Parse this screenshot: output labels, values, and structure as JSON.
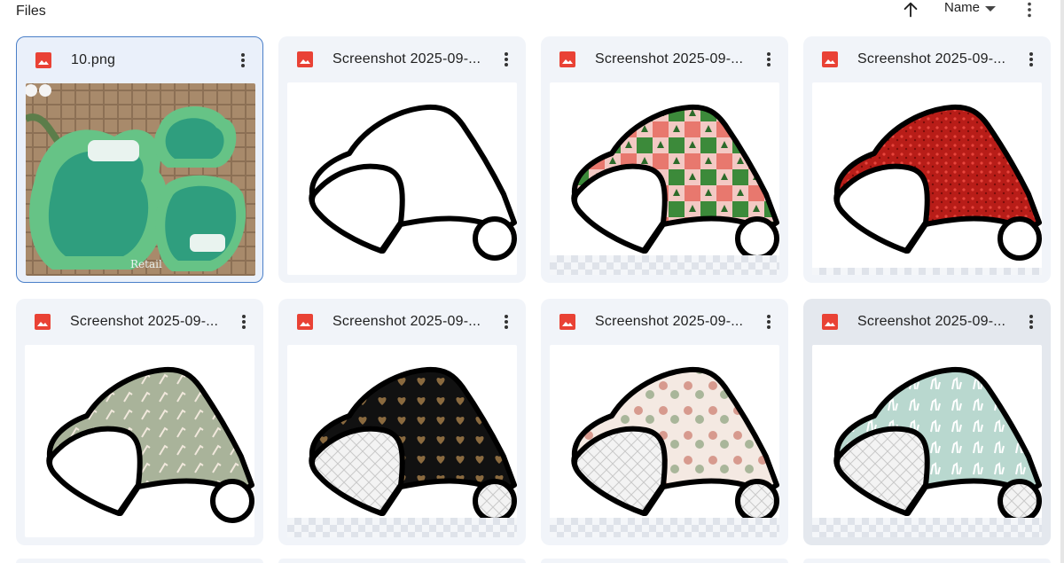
{
  "header": {
    "title": "Files",
    "sort_label": "Name"
  },
  "files": [
    {
      "name": "10.png",
      "type": "image",
      "thumb": "duck-mold",
      "selected": true
    },
    {
      "name": "Screenshot 2025-09-...",
      "type": "image",
      "thumb": "hat-outline"
    },
    {
      "name": "Screenshot 2025-09-...",
      "type": "image",
      "thumb": "hat-checker"
    },
    {
      "name": "Screenshot 2025-09-...",
      "type": "image",
      "thumb": "hat-red-glitter"
    },
    {
      "name": "Screenshot 2025-09-...",
      "type": "image",
      "thumb": "hat-candy-cane"
    },
    {
      "name": "Screenshot 2025-09-...",
      "type": "image",
      "thumb": "hat-leopard-hearts"
    },
    {
      "name": "Screenshot 2025-09-...",
      "type": "image",
      "thumb": "hat-ornaments"
    },
    {
      "name": "Screenshot 2025-09-...",
      "type": "image",
      "thumb": "hat-llama",
      "hover": true
    }
  ],
  "thumb_text": {
    "duck_watermark": "Retail"
  },
  "icons": {
    "sort": "arrow-up-icon",
    "more": "more-vertical-icon",
    "file": "image-file-icon"
  },
  "colors": {
    "image_icon": "#e94235",
    "selected_border": "#4a7fc8",
    "card_bg": "#f1f4f9"
  }
}
